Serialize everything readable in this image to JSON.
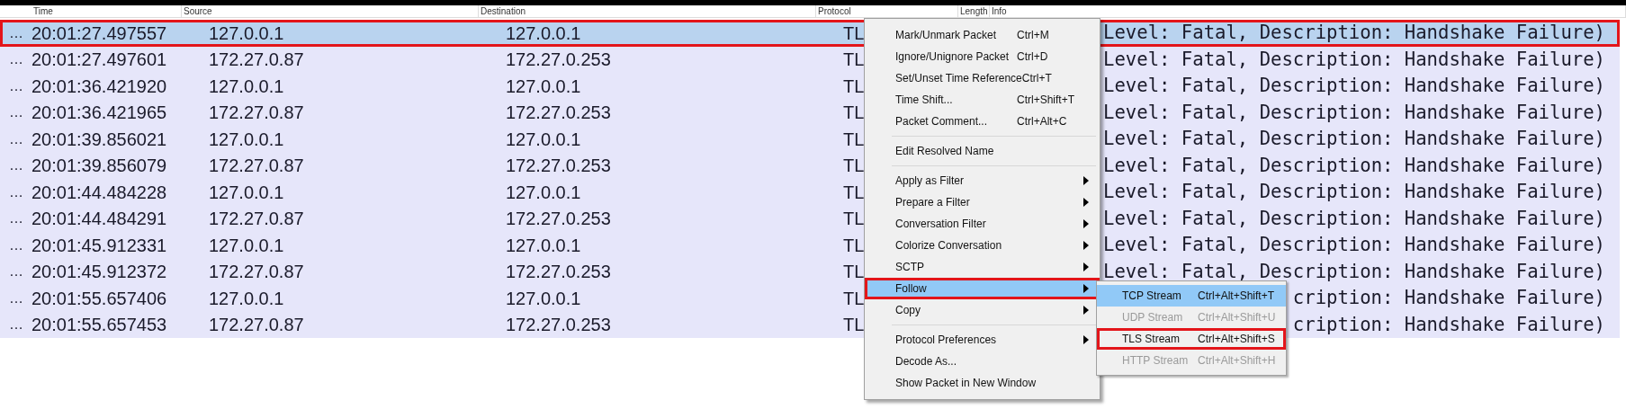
{
  "table": {
    "columns": [
      "Time",
      "Source",
      "Destination",
      "Protocol",
      "Length",
      "Info"
    ],
    "rows": [
      {
        "marker": "…",
        "time": "20:01:27.497557",
        "source": "127.0.0.1",
        "destination": "127.0.0.1",
        "protocol": "TL",
        "info": "Level: Fatal, Description: Handshake Failure)",
        "selected": true,
        "annotated": true
      },
      {
        "marker": "…",
        "time": "20:01:27.497601",
        "source": "172.27.0.87",
        "destination": "172.27.0.253",
        "protocol": "TL",
        "info": "Level: Fatal, Description: Handshake Failure)",
        "selected": false,
        "annotated": false
      },
      {
        "marker": "…",
        "time": "20:01:36.421920",
        "source": "127.0.0.1",
        "destination": "127.0.0.1",
        "protocol": "TL",
        "info": "Level: Fatal, Description: Handshake Failure)",
        "selected": false,
        "annotated": false
      },
      {
        "marker": "…",
        "time": "20:01:36.421965",
        "source": "172.27.0.87",
        "destination": "172.27.0.253",
        "protocol": "TL",
        "info": "Level: Fatal, Description: Handshake Failure)",
        "selected": false,
        "annotated": false
      },
      {
        "marker": "…",
        "time": "20:01:39.856021",
        "source": "127.0.0.1",
        "destination": "127.0.0.1",
        "protocol": "TL",
        "info": "Level: Fatal, Description: Handshake Failure)",
        "selected": false,
        "annotated": false
      },
      {
        "marker": "…",
        "time": "20:01:39.856079",
        "source": "172.27.0.87",
        "destination": "172.27.0.253",
        "protocol": "TL",
        "info": "Level: Fatal, Description: Handshake Failure)",
        "selected": false,
        "annotated": false
      },
      {
        "marker": "…",
        "time": "20:01:44.484228",
        "source": "127.0.0.1",
        "destination": "127.0.0.1",
        "protocol": "TL",
        "info": "Level: Fatal, Description: Handshake Failure)",
        "selected": false,
        "annotated": false
      },
      {
        "marker": "…",
        "time": "20:01:44.484291",
        "source": "172.27.0.87",
        "destination": "172.27.0.253",
        "protocol": "TL",
        "info": "Level: Fatal, Description: Handshake Failure)",
        "selected": false,
        "annotated": false
      },
      {
        "marker": "…",
        "time": "20:01:45.912331",
        "source": "127.0.0.1",
        "destination": "127.0.0.1",
        "protocol": "TL",
        "info": "Level: Fatal, Description: Handshake Failure)",
        "selected": false,
        "annotated": false
      },
      {
        "marker": "…",
        "time": "20:01:45.912372",
        "source": "172.27.0.87",
        "destination": "172.27.0.253",
        "protocol": "TL",
        "info": "Level: Fatal, Description: Handshake Failure)",
        "selected": false,
        "annotated": false
      },
      {
        "marker": "…",
        "time": "20:01:55.657406",
        "source": "127.0.0.1",
        "destination": "127.0.0.1",
        "protocol": "TL",
        "info": "cription: Handshake Failure)",
        "selected": false,
        "annotated": false
      },
      {
        "marker": "…",
        "time": "20:01:55.657453",
        "source": "172.27.0.87",
        "destination": "172.27.0.253",
        "protocol": "TL",
        "info": "cription: Handshake Failure)",
        "selected": false,
        "annotated": false
      }
    ]
  },
  "context_menu": {
    "groups": [
      [
        {
          "label": "Mark/Unmark Packet",
          "shortcut": "Ctrl+M",
          "submenu": false,
          "selected": false,
          "annotated": false
        },
        {
          "label": "Ignore/Unignore Packet",
          "shortcut": "Ctrl+D",
          "submenu": false,
          "selected": false,
          "annotated": false
        },
        {
          "label": "Set/Unset Time Reference",
          "shortcut": "Ctrl+T",
          "submenu": false,
          "selected": false,
          "annotated": false
        },
        {
          "label": "Time Shift...",
          "shortcut": "Ctrl+Shift+T",
          "submenu": false,
          "selected": false,
          "annotated": false
        },
        {
          "label": "Packet Comment...",
          "shortcut": "Ctrl+Alt+C",
          "submenu": false,
          "selected": false,
          "annotated": false
        }
      ],
      [
        {
          "label": "Edit Resolved Name",
          "submenu": false,
          "selected": false,
          "annotated": false
        }
      ],
      [
        {
          "label": "Apply as Filter",
          "submenu": true,
          "selected": false,
          "annotated": false
        },
        {
          "label": "Prepare a Filter",
          "submenu": true,
          "selected": false,
          "annotated": false
        },
        {
          "label": "Conversation Filter",
          "submenu": true,
          "selected": false,
          "annotated": false
        },
        {
          "label": "Colorize Conversation",
          "submenu": true,
          "selected": false,
          "annotated": false
        },
        {
          "label": "SCTP",
          "submenu": true,
          "selected": false,
          "annotated": false
        },
        {
          "label": "Follow",
          "submenu": true,
          "selected": true,
          "annotated": true
        },
        {
          "label": "Copy",
          "submenu": true,
          "selected": false,
          "annotated": false
        }
      ],
      [
        {
          "label": "Protocol Preferences",
          "submenu": true,
          "selected": false,
          "annotated": false
        },
        {
          "label": "Decode As...",
          "submenu": false,
          "selected": false,
          "annotated": false
        },
        {
          "label": "Show Packet in New Window",
          "submenu": false,
          "selected": false,
          "annotated": false
        }
      ]
    ]
  },
  "submenu": {
    "items": [
      {
        "label": "TCP Stream",
        "shortcut": "Ctrl+Alt+Shift+T",
        "disabled": false,
        "selected": true,
        "annotated": false
      },
      {
        "label": "UDP Stream",
        "shortcut": "Ctrl+Alt+Shift+U",
        "disabled": true,
        "selected": false,
        "annotated": false
      },
      {
        "label": "TLS Stream",
        "shortcut": "Ctrl+Alt+Shift+S",
        "disabled": false,
        "selected": false,
        "annotated": true
      },
      {
        "label": "HTTP Stream",
        "shortcut": "Ctrl+Alt+Shift+H",
        "disabled": true,
        "selected": false,
        "annotated": false
      }
    ]
  }
}
